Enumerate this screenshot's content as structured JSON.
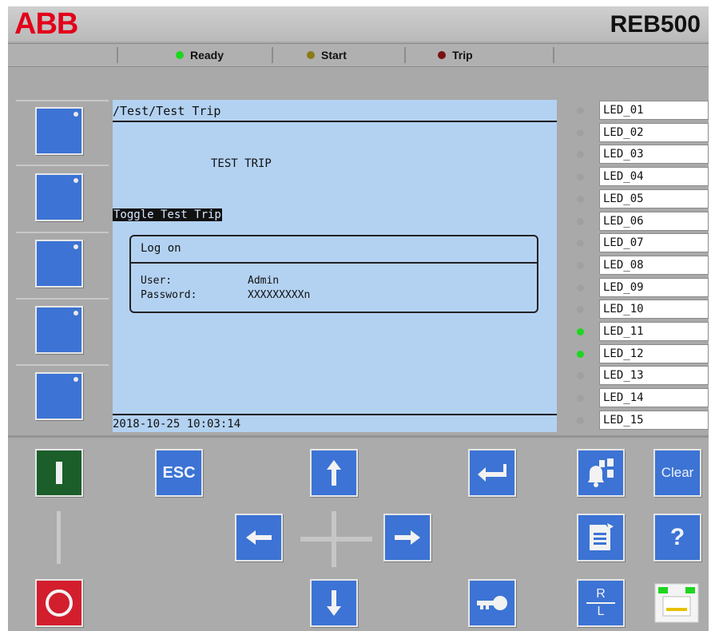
{
  "header": {
    "brand": "ABB",
    "model": "REB500"
  },
  "status": [
    {
      "label": "Ready",
      "color": "#1ed61e"
    },
    {
      "label": "Start",
      "color": "#8a7a1a"
    },
    {
      "label": "Trip",
      "color": "#7a1010"
    }
  ],
  "lcd": {
    "path": "/Test/Test Trip",
    "title": "TEST TRIP",
    "selected_item": "Toggle Test Trip",
    "dialog": {
      "title": "Log on",
      "user_label": "User:",
      "user_value": "Admin",
      "password_label": "Password:",
      "password_value": "XXXXXXXXXn"
    },
    "datetime": "2018-10-25 10:03:14"
  },
  "leds": [
    {
      "label": "LED_01",
      "on": false
    },
    {
      "label": "LED_02",
      "on": false
    },
    {
      "label": "LED_03",
      "on": false
    },
    {
      "label": "LED_04",
      "on": false
    },
    {
      "label": "LED_05",
      "on": false
    },
    {
      "label": "LED_06",
      "on": false
    },
    {
      "label": "LED_07",
      "on": false
    },
    {
      "label": "LED_08",
      "on": false
    },
    {
      "label": "LED_09",
      "on": false
    },
    {
      "label": "LED_10",
      "on": false
    },
    {
      "label": "LED_11",
      "on": true
    },
    {
      "label": "LED_12",
      "on": true
    },
    {
      "label": "LED_13",
      "on": false
    },
    {
      "label": "LED_14",
      "on": false
    },
    {
      "label": "LED_15",
      "on": false
    }
  ],
  "keys": {
    "esc": "ESC",
    "clear": "Clear",
    "help": "?",
    "remote_local_top": "R",
    "remote_local_bottom": "L"
  },
  "colors": {
    "key_blue": "#3c73d4",
    "power_on": "#1b5e2a",
    "power_off": "#d21e2d",
    "lcd_background": "#b3d2f2",
    "led_on": "#1ed61e"
  }
}
